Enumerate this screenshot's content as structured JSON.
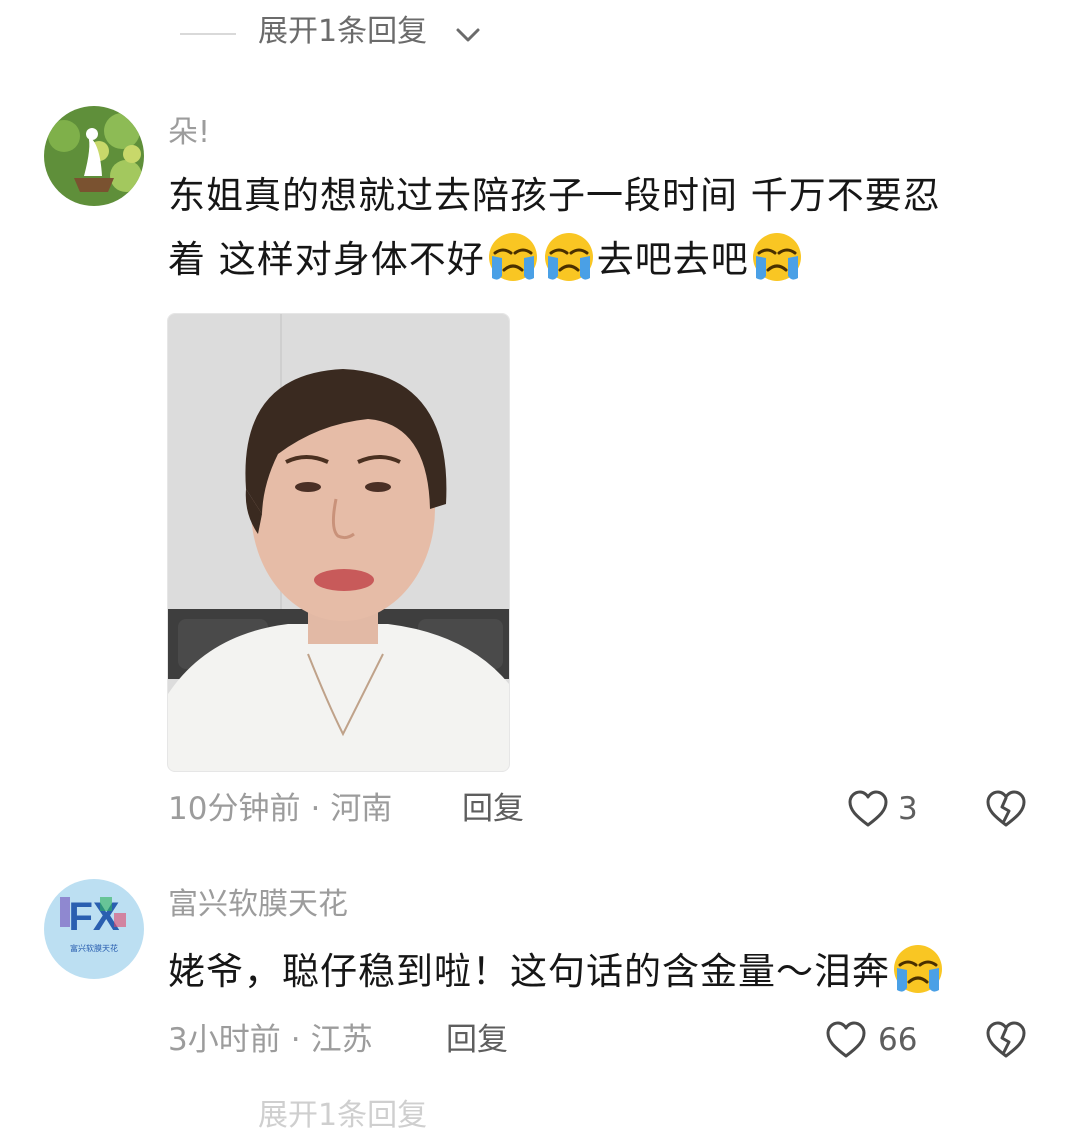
{
  "expand_top": {
    "label": "展开1条回复"
  },
  "comments": [
    {
      "username": "朵!",
      "line1": "东姐真的想就过去陪孩子一段时间  千万不要忍",
      "line2a": "着  这样对身体不好",
      "line2b": "去吧去吧",
      "time": "10分钟前",
      "location": "河南",
      "reply_label": "回复",
      "like_count": "3"
    },
    {
      "username": "富兴软膜天花",
      "avatar_text": "FX",
      "avatar_subtext": "富兴软膜天花",
      "content": "姥爷，聪仔稳到啦！这句话的含金量～泪奔",
      "time": "3小时前",
      "location": "江苏",
      "reply_label": "回复",
      "like_count": "66"
    }
  ],
  "expand_bottom": {
    "label": "展开1条回复"
  },
  "icons": [
    "chevron-down-icon",
    "crying-emoji-icon",
    "heart-icon",
    "broken-heart-icon"
  ],
  "colors": {
    "text_primary": "#161616",
    "text_secondary": "#9c9c9c",
    "emoji_yellow": "#f9c623",
    "tear_blue": "#4aa0e6"
  }
}
